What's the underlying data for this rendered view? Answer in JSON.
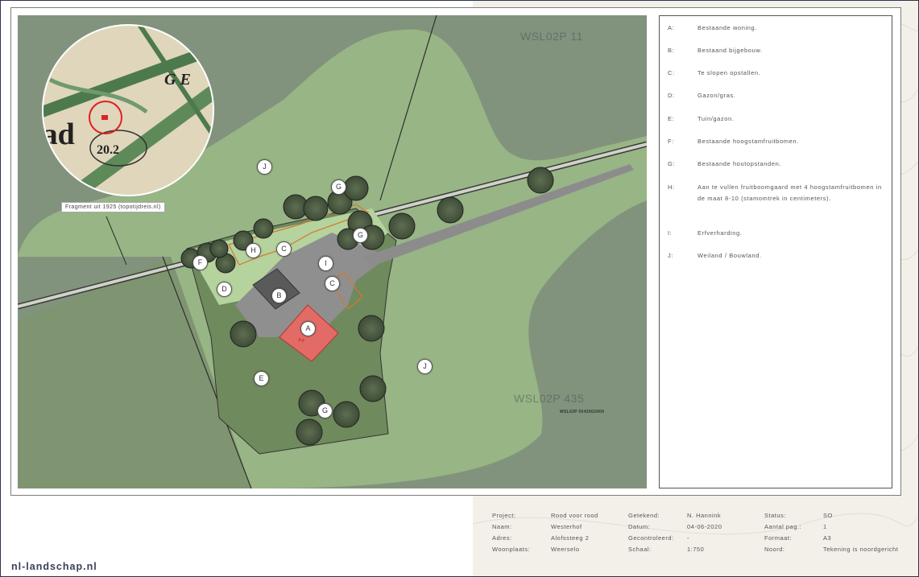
{
  "brand": "nl-landschap.nl",
  "map": {
    "parcel_labels": [
      "WSL02P   11",
      "WSL02P   435"
    ],
    "parcel_code": "WSL02P  00435G0000",
    "inset_caption": "Fragment uit 1925 (topotijdreis.nl)",
    "inset_text": [
      "tad",
      "20.2",
      "G E"
    ],
    "house_number": "2",
    "markers": [
      "J",
      "G",
      "G",
      "H",
      "C",
      "I",
      "F",
      "D",
      "B",
      "C",
      "A",
      "E",
      "G",
      "J"
    ]
  },
  "legend": [
    {
      "key": "A:",
      "text": "Bestaande woning."
    },
    {
      "key": "B:",
      "text": "Bestaand bijgebouw."
    },
    {
      "key": "C:",
      "text": "Te slopen opstallen."
    },
    {
      "key": "D:",
      "text": "Gazon/gras."
    },
    {
      "key": "E:",
      "text": "Tuin/gazon."
    },
    {
      "key": "F:",
      "text": "Bestaande hoogstamfruitbomen."
    },
    {
      "key": "G:",
      "text": "Bestaande houtopstanden."
    },
    {
      "key": "H:",
      "text": "Aan te vullen fruitboomgaard met 4 hoogstamfruitbomen in de maat 8-10 (stamomtrek in centimeters)."
    },
    {
      "key": "I:",
      "text": "Erfverharding."
    },
    {
      "key": "J:",
      "text": "Weiland / Bouwland."
    }
  ],
  "titleblock": {
    "project_label": "Project:",
    "project": "Rood voor rood",
    "naam_label": "Naam:",
    "naam": "Westerhof",
    "adres_label": "Adres:",
    "adres": "Alofssteeg 2",
    "woonplaats_label": "Woonplaats:",
    "woonplaats": "Weerselo",
    "getekend_label": "Getekend:",
    "getekend": "N. Hannink",
    "datum_label": "Datum:",
    "datum": "04-06-2020",
    "gecontroleerd_label": "Gecontroleerd:",
    "gecontroleerd": "-",
    "schaal_label": "Schaal:",
    "schaal": "1:750",
    "status_label": "Status:",
    "status": "SO",
    "aantal_label": "Aantal pag.:",
    "aantal": "1",
    "formaat_label": "Formaat:",
    "formaat": "A3",
    "noord_label": "Noord:",
    "noord": "Tekening is noordgericht"
  },
  "colors": {
    "frame": "#2c3350",
    "field": "#8fae7c",
    "yard": "#8c8c8c",
    "house": "#d9534f",
    "demolish": "#d7762f"
  }
}
